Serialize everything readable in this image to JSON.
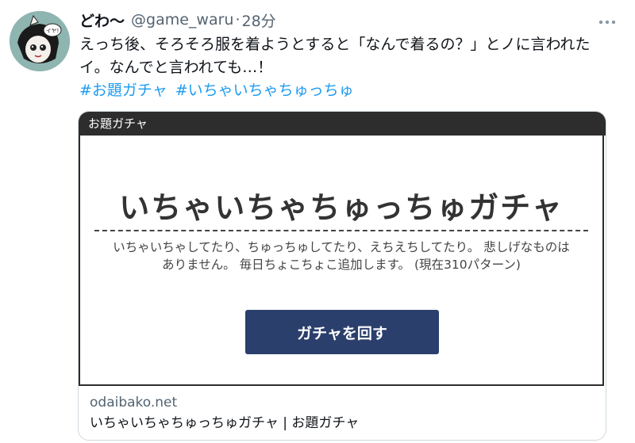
{
  "tweet": {
    "display_name": "どわ〜",
    "handle": "@game_waru",
    "separator": "·",
    "time": "28分",
    "more_icon": "more-icon",
    "text": "えっち後、そろそろ服を着ようとすると「なんで着るの？」とノに言われたイ。なんでと言われても…！",
    "hashtags": [
      "#お題ガチャ",
      "#いちゃいちゃちゅっちゅ"
    ],
    "avatar_bubble": "イヤ!"
  },
  "card": {
    "bar_label": "お題ガチャ",
    "gacha_title": "いちゃいちゃちゅっちゅガチャ",
    "description_line1": "いちゃいちゃしてたり、ちゅっちゅしてたり、えちえちしてたり。 悲しげなものは",
    "description_line2": "ありません。 毎日ちょこちょこ追加します。 (現在310パターン)",
    "button_label": "ガチャを回す",
    "domain": "odaibako.net",
    "link_title": "いちゃいちゃちゅっちゅガチャ | お題ガチャ"
  },
  "colors": {
    "link_blue": "#1d9bf0",
    "button_navy": "#2b3f6c",
    "card_bar": "#2d2d2d",
    "avatar_bg": "#8fb5b0"
  }
}
